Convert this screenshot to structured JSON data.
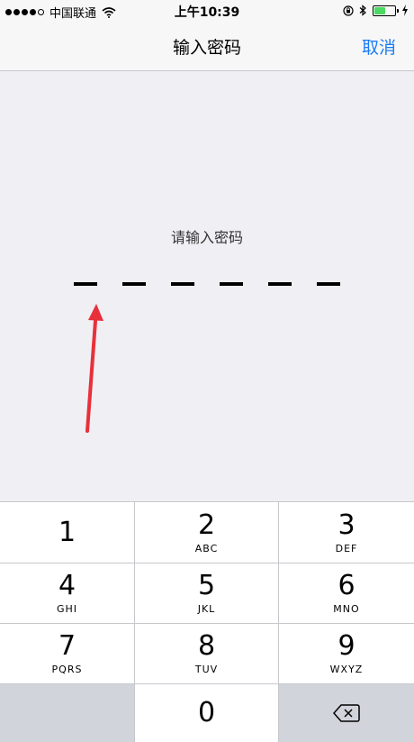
{
  "status": {
    "carrier": "中国联通",
    "time": "上午10:39",
    "battery_level": 0.55,
    "battery_color": "#4cd964"
  },
  "nav": {
    "title": "输入密码",
    "cancel": "取消",
    "accent_color": "#1a7cf5"
  },
  "prompt": "请输入密码",
  "pin_length": 6,
  "keypad": {
    "keys": [
      {
        "digit": "1",
        "letters": ""
      },
      {
        "digit": "2",
        "letters": "ABC"
      },
      {
        "digit": "3",
        "letters": "DEF"
      },
      {
        "digit": "4",
        "letters": "GHI"
      },
      {
        "digit": "5",
        "letters": "JKL"
      },
      {
        "digit": "6",
        "letters": "MNO"
      },
      {
        "digit": "7",
        "letters": "PQRS"
      },
      {
        "digit": "8",
        "letters": "TUV"
      },
      {
        "digit": "9",
        "letters": "WXYZ"
      },
      {
        "digit": "0",
        "letters": ""
      }
    ],
    "delete_icon": "backspace-icon"
  },
  "annotation": {
    "arrow_color": "#e8303a"
  }
}
